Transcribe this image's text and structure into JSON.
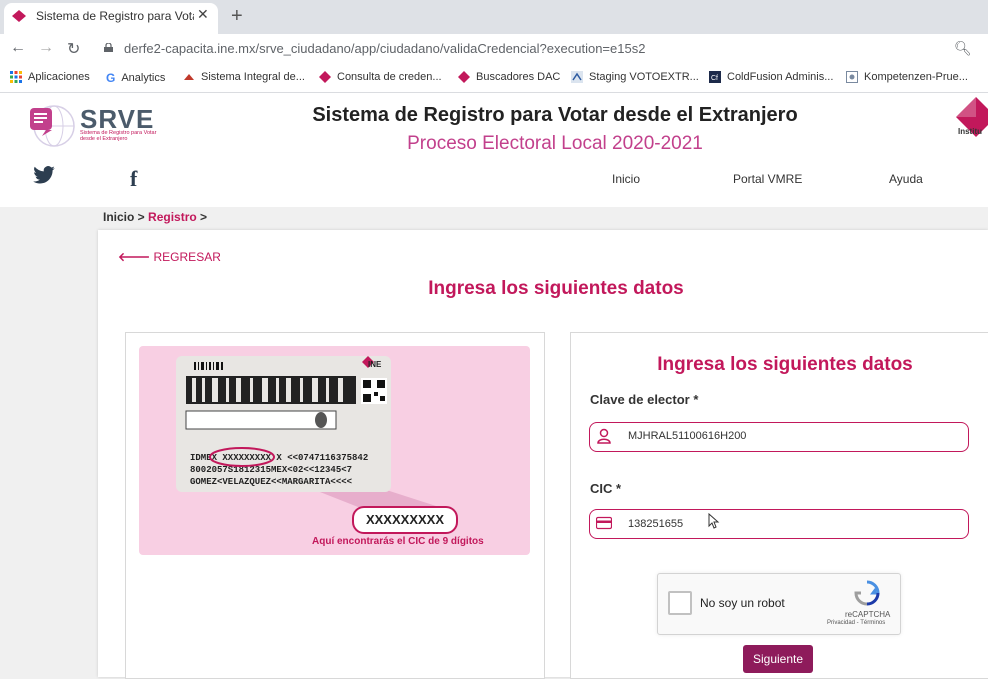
{
  "browser": {
    "tab_title": "Sistema de Registro para Votar d",
    "url": "derfe2-capacita.ine.mx/srve_ciudadano/app/ciudadano/validaCredencial?execution=e15s2",
    "bookmarks": [
      {
        "label": "Aplicaciones"
      },
      {
        "label": "Analytics"
      },
      {
        "label": "Sistema Integral de..."
      },
      {
        "label": "Consulta de creden..."
      },
      {
        "label": "Buscadores DAC"
      },
      {
        "label": "Staging VOTOEXTR..."
      },
      {
        "label": "ColdFusion Adminis..."
      },
      {
        "label": "Kompetenzen-Prue..."
      }
    ]
  },
  "site": {
    "logo_text": "SRVE",
    "logo_subtitle": "Sistema de Registro para Votar desde el Extranjero",
    "title": "Sistema de Registro para Votar desde el Extranjero",
    "subtitle": "Proceso Electoral Local 2020-2021",
    "brand_right": "Institu",
    "nav": [
      "Inicio",
      "Portal VMRE",
      "Ayuda"
    ]
  },
  "breadcrumb": {
    "home": "Inicio",
    "sep": " > ",
    "current": "Registro",
    "tail": " >"
  },
  "page": {
    "back_label": "REGRESAR",
    "heading": "Ingresa los siguientes datos"
  },
  "id_card": {
    "idmex_line": "IDMEX XXXXXXXXX X <<0747116375842",
    "line2": "8002057S1812315MEX<02<<12345<7",
    "line3": "GOMEZ<VELAZQUEZ<<MARGARITA<<<<",
    "cic_placeholder": "XXXXXXXXX",
    "caption": "Aquí encontrarás el CIC de 9 dígitos",
    "brand": "INE"
  },
  "form": {
    "heading": "Ingresa los siguientes datos",
    "clave_label": "Clave de elector *",
    "clave_value": "MJHRAL51100616H200",
    "cic_label": "CIC *",
    "cic_value": "138251655",
    "captcha_label": "No soy un robot",
    "captcha_brand": "reCAPTCHA",
    "captcha_links": "Privacidad - Términos",
    "submit_label": "Siguiente"
  },
  "colors": {
    "accent": "#c2185b",
    "button": "#8e1b5b",
    "card_bg": "#f8cfe3"
  }
}
